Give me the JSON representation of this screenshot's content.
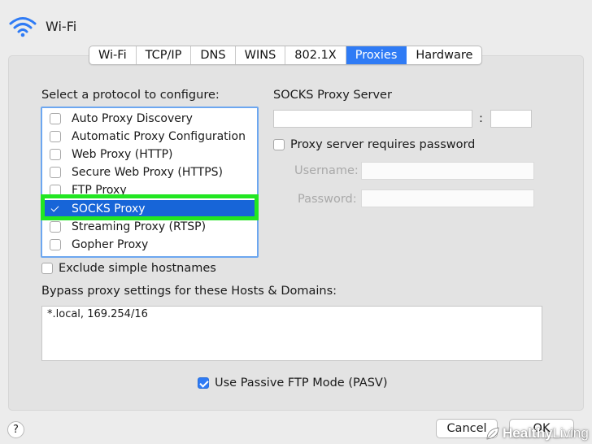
{
  "window": {
    "title": "Wi-Fi"
  },
  "tabs": [
    {
      "label": "Wi-Fi"
    },
    {
      "label": "TCP/IP"
    },
    {
      "label": "DNS"
    },
    {
      "label": "WINS"
    },
    {
      "label": "802.1X"
    },
    {
      "label": "Proxies",
      "active": true
    },
    {
      "label": "Hardware"
    }
  ],
  "protocols": {
    "heading": "Select a protocol to configure:",
    "items": [
      {
        "label": "Auto Proxy Discovery",
        "checked": false
      },
      {
        "label": "Automatic Proxy Configuration",
        "checked": false
      },
      {
        "label": "Web Proxy (HTTP)",
        "checked": false
      },
      {
        "label": "Secure Web Proxy (HTTPS)",
        "checked": false
      },
      {
        "label": "FTP Proxy",
        "checked": false
      },
      {
        "label": "SOCKS Proxy",
        "checked": true,
        "selected": true
      },
      {
        "label": "Streaming Proxy (RTSP)",
        "checked": false
      },
      {
        "label": "Gopher Proxy",
        "checked": false
      }
    ]
  },
  "server": {
    "heading": "SOCKS Proxy Server",
    "colon": ":",
    "address": "",
    "port": "",
    "requires_password": {
      "label": "Proxy server requires password",
      "checked": false
    },
    "username_label": "Username:",
    "password_label": "Password:"
  },
  "exclude_simple": {
    "label": "Exclude simple hostnames",
    "checked": false
  },
  "bypass": {
    "label": "Bypass proxy settings for these Hosts & Domains:",
    "value": "*.local, 169.254/16"
  },
  "passive_ftp": {
    "label": "Use Passive FTP Mode (PASV)",
    "checked": true
  },
  "footer": {
    "help": "?",
    "cancel": "Cancel",
    "ok": "OK"
  },
  "watermark": {
    "brand_bold": "Healthy",
    "brand_light": "Living"
  },
  "colors": {
    "accent": "#2f7bf5",
    "selection": "#1765d8",
    "highlight": "#22e622"
  }
}
